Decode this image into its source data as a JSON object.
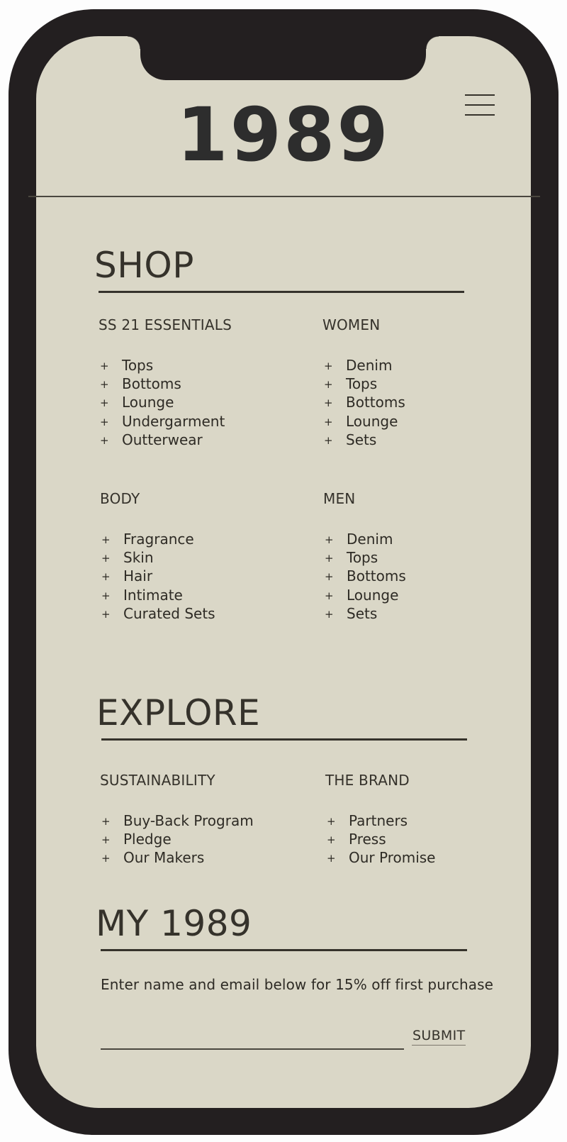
{
  "brand": {
    "logo_text": "1989"
  },
  "icons": {
    "menu": "hamburger-menu-icon",
    "bullet": "plus-icon"
  },
  "colors": {
    "frame": "#231f20",
    "screen": "#dad7c7",
    "text": "#35322b"
  },
  "shop": {
    "title": "SHOP",
    "columns": [
      {
        "heading": "SS 21 ESSENTIALS",
        "items": [
          "Tops",
          "Bottoms",
          "Lounge",
          "Undergarment",
          "Outterwear"
        ]
      },
      {
        "heading": "WOMEN",
        "items": [
          "Denim",
          "Tops",
          "Bottoms",
          "Lounge",
          "Sets"
        ]
      },
      {
        "heading": "BODY",
        "items": [
          "Fragrance",
          "Skin",
          "Hair",
          "Intimate",
          "Curated Sets"
        ]
      },
      {
        "heading": "MEN",
        "items": [
          "Denim",
          "Tops",
          "Bottoms",
          "Lounge",
          "Sets"
        ]
      }
    ]
  },
  "explore": {
    "title": "EXPLORE",
    "columns": [
      {
        "heading": "SUSTAINABILITY",
        "items": [
          "Buy-Back Program",
          "Pledge",
          "Our Makers"
        ]
      },
      {
        "heading": "THE BRAND",
        "items": [
          "Partners",
          "Press",
          "Our Promise"
        ]
      }
    ]
  },
  "signup": {
    "title": "MY 1989",
    "promo": "Enter name and email below for 15% off first purchase",
    "input_value": "",
    "submit_label": "SUBMIT"
  }
}
